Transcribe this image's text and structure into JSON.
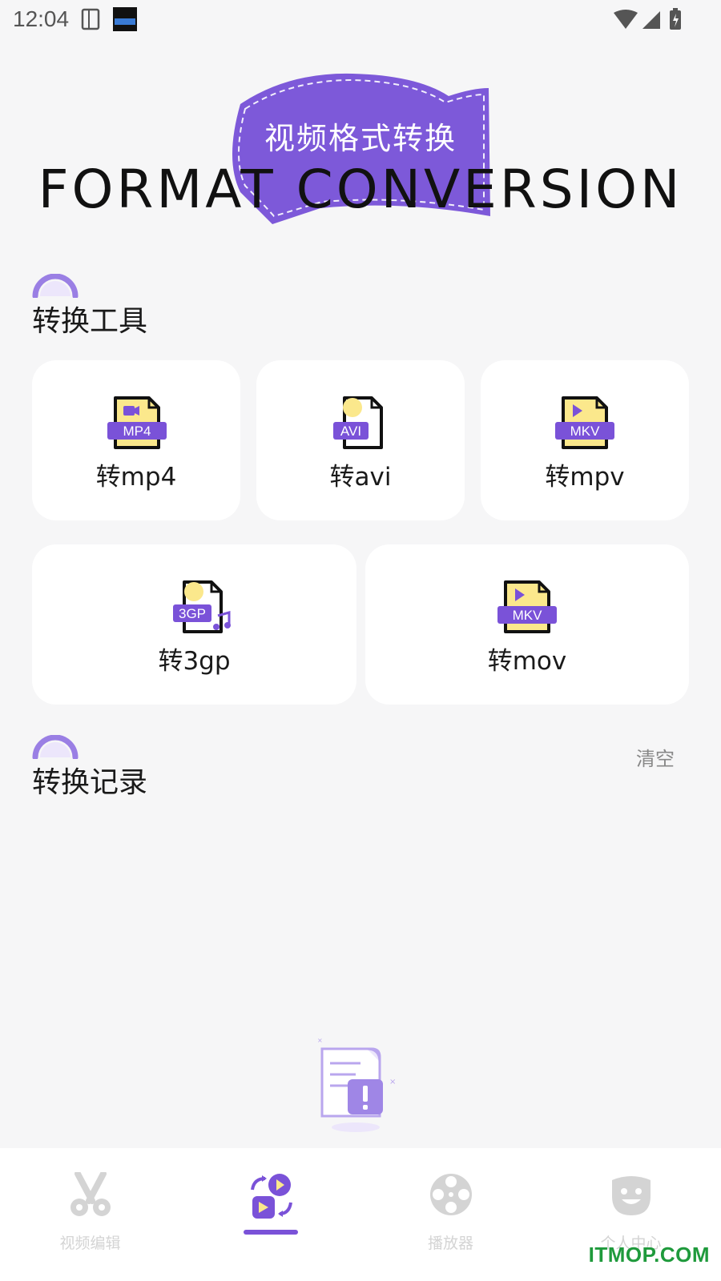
{
  "status_bar": {
    "time": "12:04"
  },
  "banner": {
    "subtitle": "视频格式转换",
    "title": "FORMAT CONVERSION"
  },
  "tools_section": {
    "title": "转换工具",
    "cards": [
      {
        "badge": "MP4",
        "label": "转mp4"
      },
      {
        "badge": "AVI",
        "label": "转avi"
      },
      {
        "badge": "MKV",
        "label": "转mpv"
      },
      {
        "badge": "3GP",
        "label": "转3gp"
      },
      {
        "badge": "MKV",
        "label": "转mov"
      }
    ]
  },
  "records_section": {
    "title": "转换记录",
    "clear_label": "清空"
  },
  "bottom_nav": {
    "items": [
      {
        "label": "视频编辑",
        "icon": "scissors-icon"
      },
      {
        "label": "",
        "icon": "convert-icon",
        "active": true
      },
      {
        "label": "播放器",
        "icon": "film-reel-icon"
      },
      {
        "label": "个人中心",
        "icon": "smiley-icon"
      }
    ]
  },
  "watermark": "ITMOP.COM",
  "colors": {
    "accent": "#7a52d8",
    "file_yellow": "#fbe88c",
    "background": "#f6f6f7"
  }
}
